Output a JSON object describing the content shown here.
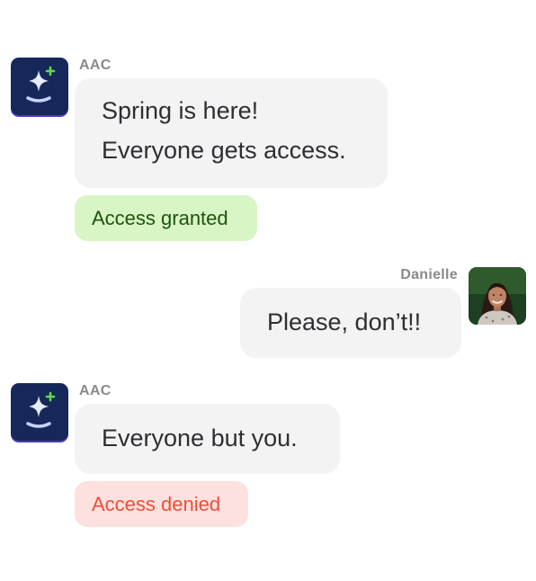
{
  "conversation": {
    "messages": [
      {
        "sender": "AAC",
        "avatar_icon": "sparkle-bot-icon",
        "lines": [
          "Spring is here!",
          "Everyone gets access."
        ],
        "status": {
          "label": "Access granted",
          "kind": "granted",
          "color": "#1f5212",
          "background": "#d8f5c5"
        }
      },
      {
        "sender": "Danielle",
        "avatar_icon": "user-photo",
        "lines": [
          "Please, don’t!!"
        ]
      },
      {
        "sender": "AAC",
        "avatar_icon": "sparkle-bot-icon",
        "lines": [
          "Everyone but you."
        ],
        "status": {
          "label": "Access denied",
          "kind": "denied",
          "color": "#ee4d3a",
          "background": "#fde1de"
        }
      }
    ]
  },
  "colors": {
    "bot_avatar": "#16285a",
    "sparkle_plus": "#62d84e",
    "bubble": "#f3f3f3",
    "text": "#2e2e33",
    "sender": "#8a8a8a"
  }
}
